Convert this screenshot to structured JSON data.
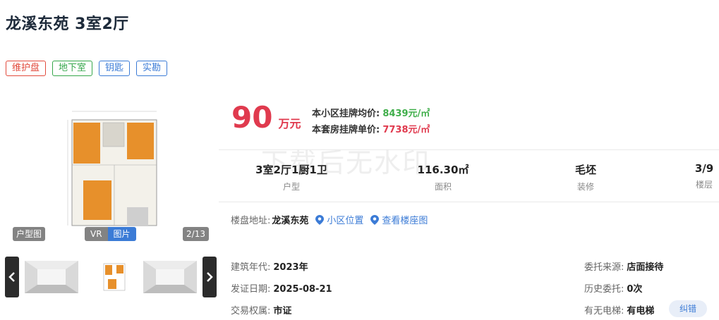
{
  "title": "龙溪东苑 3室2厅",
  "tags": [
    {
      "label": "维护盘",
      "color": "#e24a3c"
    },
    {
      "label": "地下室",
      "color": "#36a74b"
    },
    {
      "label": "钥匙",
      "color": "#3b7bd6"
    },
    {
      "label": "实勘",
      "color": "#3b7bd6"
    }
  ],
  "gallery": {
    "plan_badge": "户型图",
    "vr_label": "VR",
    "pic_label": "图片",
    "counter": "2/13"
  },
  "watermark": "下载后无水印",
  "price": {
    "value": "90",
    "unit": "万元",
    "community_avg_label": "本小区挂牌均价:",
    "community_avg_value": "8439元/㎡",
    "unit_price_label": "本套房挂牌单价:",
    "unit_price_value": "7738元/㎡"
  },
  "stats": [
    {
      "value": "3室2厅1厨1卫",
      "label": "户型"
    },
    {
      "value": "116.30㎡",
      "label": "面积"
    },
    {
      "value": "毛坯",
      "label": "装修"
    },
    {
      "value": "3/9",
      "label": "楼层"
    }
  ],
  "address": {
    "label": "楼盘地址:",
    "value": "龙溪东苑",
    "link1": "小区位置",
    "link2": "查看楼座图"
  },
  "info": {
    "build_year_label": "建筑年代:",
    "build_year": "2023年",
    "cert_date_label": "发证日期:",
    "cert_date": "2025-08-21",
    "ownership_label": "交易权属:",
    "ownership": "市证",
    "source_label": "委托来源:",
    "source": "店面接待",
    "history_label": "历史委托:",
    "history": "0次",
    "elevator_label": "有无电梯:",
    "elevator": "有电梯",
    "fix_label": "纠错"
  }
}
